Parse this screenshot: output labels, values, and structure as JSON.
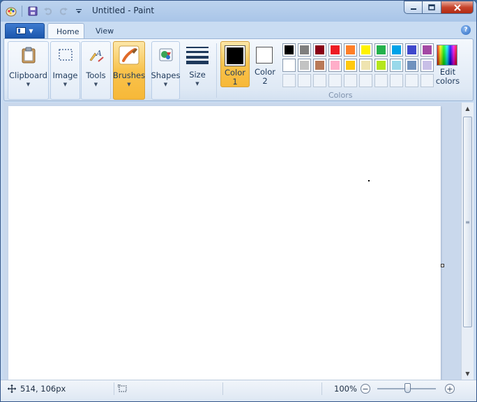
{
  "window": {
    "title": "Untitled - Paint"
  },
  "tabs": {
    "home": "Home",
    "view": "View"
  },
  "ribbon": {
    "clipboard": "Clipboard",
    "image": "Image",
    "tools": "Tools",
    "brushes": "Brushes",
    "shapes": "Shapes",
    "size": "Size",
    "color1_line1": "Color",
    "color1_line2": "1",
    "color2_line1": "Color",
    "color2_line2": "2",
    "edit_colors_line1": "Edit",
    "edit_colors_line2": "colors",
    "colors_caption": "Colors"
  },
  "palette": {
    "row1": [
      "#000000",
      "#7f7f7f",
      "#880015",
      "#ed1c24",
      "#ff7f27",
      "#fff200",
      "#22b14c",
      "#00a2e8",
      "#3f48cc",
      "#a349a4"
    ],
    "row2": [
      "#ffffff",
      "#c3c3c3",
      "#b97a57",
      "#ffaec9",
      "#ffc90e",
      "#efe4b0",
      "#b5e61d",
      "#99d9ea",
      "#7092be",
      "#c8bfe7"
    ],
    "row3_empty_count": 10,
    "color1": "#000000",
    "color2": "#ffffff"
  },
  "status": {
    "cursor_position": "514, 106px",
    "zoom": "100%",
    "zoom_fraction": 0.5
  },
  "colors": {
    "selection_accent": "#f8c34d",
    "title_bar": "#bcd3ee",
    "close_button": "#c7442c"
  }
}
